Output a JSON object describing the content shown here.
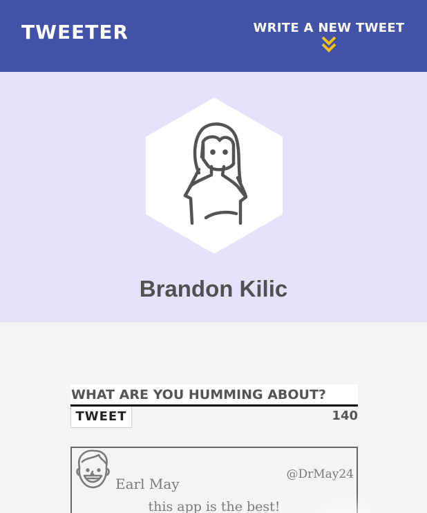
{
  "navbar": {
    "brand": "TWEETER",
    "compose_link": "WRITE A NEW TWEET",
    "chevron_icon": "double-chevron-down-icon",
    "background_color": "#4152a8",
    "chevron_color": "#f5c211"
  },
  "profile": {
    "name": "Brandon Kilic",
    "avatar_icon": "female-avatar-icon",
    "background_color": "#e6e2fb"
  },
  "composer": {
    "placeholder": "What are you humming about?",
    "button_label": "TWEET",
    "char_counter": "140"
  },
  "tweets": [
    {
      "author": "Earl May",
      "handle": "@DrMay24",
      "text": "this app is the best!",
      "avatar_icon": "male-avatar-icon"
    }
  ]
}
